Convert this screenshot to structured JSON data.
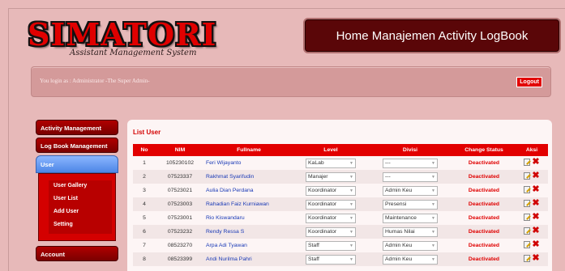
{
  "header": {
    "logo_text": "SIMATORI",
    "logo_subtitle": "Assistant Management System",
    "page_title": "Home Manajemen Activity LogBook"
  },
  "login_bar": {
    "text": "You login as : Administrator -The Super Admin-",
    "logout_label": "Logout"
  },
  "sidebar": {
    "items": [
      {
        "label": "Activity Management"
      },
      {
        "label": "Log Book Management"
      },
      {
        "label": "User"
      }
    ],
    "submenu": [
      {
        "label": "User Gallery"
      },
      {
        "label": "User List"
      },
      {
        "label": "Add User"
      },
      {
        "label": "Setting"
      }
    ],
    "account_label": "Account"
  },
  "main": {
    "section_title": "List User",
    "columns": [
      "No",
      "NIM",
      "Fullname",
      "Level",
      "Divisi",
      "Change Status",
      "Aksi"
    ],
    "rows": [
      {
        "no": "1",
        "nim": "105230102",
        "fullname": "Feri Wijayanto",
        "level": "KaLab",
        "divisi": "---",
        "status": "Deactivated"
      },
      {
        "no": "2",
        "nim": "07523337",
        "fullname": "Rakhmat Syarifudin",
        "level": "Manajer",
        "divisi": "---",
        "status": "Deactivated"
      },
      {
        "no": "3",
        "nim": "07523021",
        "fullname": "Aulia Dian Perdana",
        "level": "Koordinator",
        "divisi": "Admin Keu",
        "status": "Deactivated"
      },
      {
        "no": "4",
        "nim": "07523003",
        "fullname": "Rahadian Faiz Kurniawan",
        "level": "Koordinator",
        "divisi": "Presensi",
        "status": "Deactivated"
      },
      {
        "no": "5",
        "nim": "07523001",
        "fullname": "Rio Kiswandaru",
        "level": "Koordinator",
        "divisi": "Maintenance",
        "status": "Deactivated"
      },
      {
        "no": "6",
        "nim": "07523232",
        "fullname": "Rendy Ressa S",
        "level": "Koordinator",
        "divisi": "Humas Nilai",
        "status": "Deactivated"
      },
      {
        "no": "7",
        "nim": "08523270",
        "fullname": "Arpa Adi Tyawan",
        "level": "Staff",
        "divisi": "Admin Keu",
        "status": "Deactivated"
      },
      {
        "no": "8",
        "nim": "08523399",
        "fullname": "Andi Nurilma Pahri",
        "level": "Staff",
        "divisi": "Admin Keu",
        "status": "Deactivated"
      }
    ]
  },
  "colors": {
    "brand_red": "#e20000",
    "title_box": "#5a0608",
    "page_bg": "#e7b9b9",
    "link_blue": "#1a3ab6"
  }
}
